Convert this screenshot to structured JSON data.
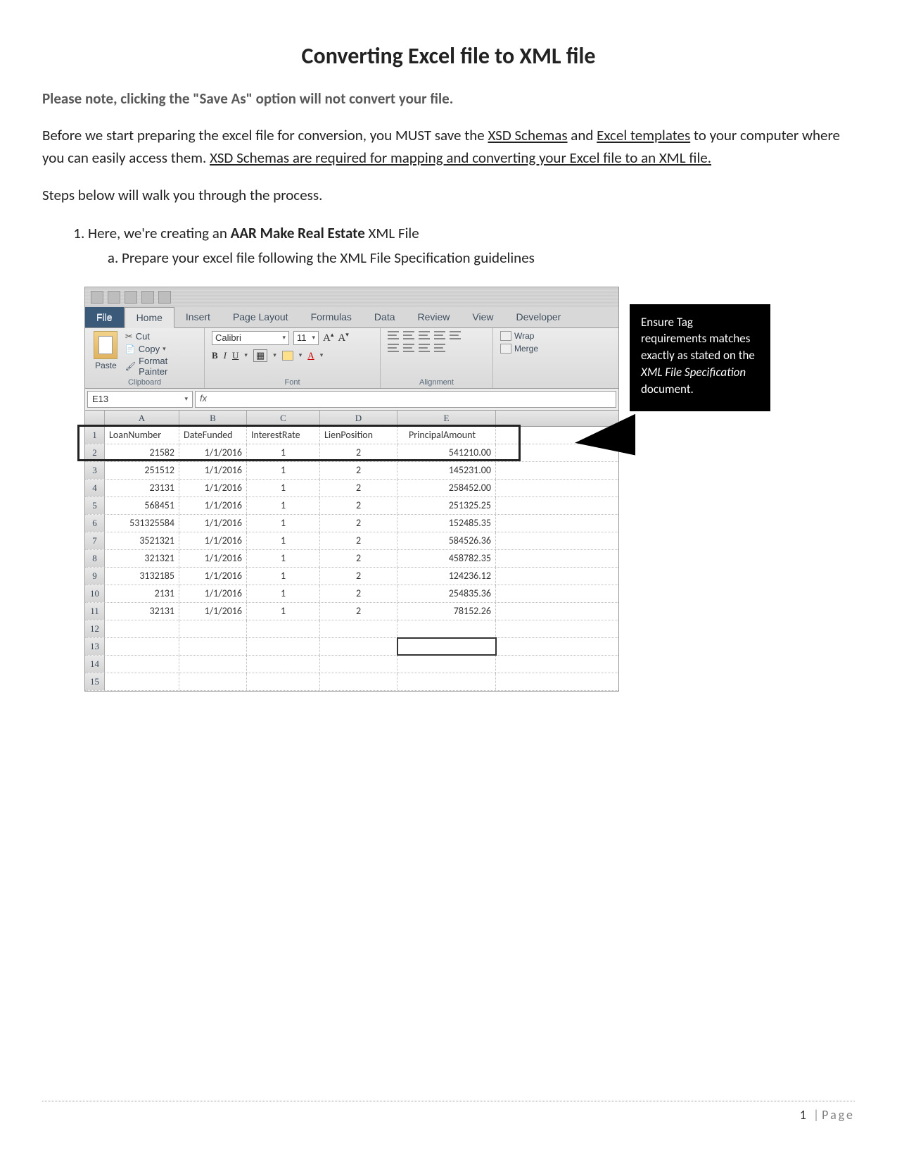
{
  "title": "Converting Excel file to XML file",
  "note": "Please note, clicking the \"Save As\" option will not convert your file.",
  "intro_a": "Before we start preparing the excel file for conversion, you MUST save the ",
  "intro_link1": "XSD Schemas",
  "intro_mid": " and ",
  "intro_link2": "Excel templates",
  "intro_b": " to your computer where you can easily access them. ",
  "intro_link3": "XSD Schemas are required for mapping and converting your Excel file to an XML file.",
  "intro2": "Steps below will walk you through the process.",
  "step1_a": "Here, we're creating an ",
  "step1_bold": "AAR Make Real Estate",
  "step1_b": " XML File",
  "step1a": "Prepare your excel file following the XML File Specification guidelines",
  "callout_a": "Ensure Tag requirements matches exactly as stated on the ",
  "callout_i": "XML File Specification",
  "callout_b": " document.",
  "ribbon": {
    "tabs": [
      "File",
      "Home",
      "Insert",
      "Page Layout",
      "Formulas",
      "Data",
      "Review",
      "View",
      "Developer"
    ],
    "cut": "Cut",
    "copy": "Copy",
    "format_painter": "Format Painter",
    "paste": "Paste",
    "clipboard_label": "Clipboard",
    "font_name": "Calibri",
    "font_size": "11",
    "font_label": "Font",
    "alignment_label": "Alignment",
    "wrap": "Wrap",
    "merge": "Merge",
    "name_box": "E13",
    "fx": "fx"
  },
  "columns": [
    "A",
    "B",
    "C",
    "D",
    "E"
  ],
  "headers": [
    "LoanNumber",
    "DateFunded",
    "InterestRate",
    "LienPosition",
    "PrincipalAmount"
  ],
  "rows": [
    {
      "n": "1"
    },
    {
      "n": "2",
      "a": "21582",
      "b": "1/1/2016",
      "c": "1",
      "d": "2",
      "e": "541210.00"
    },
    {
      "n": "3",
      "a": "251512",
      "b": "1/1/2016",
      "c": "1",
      "d": "2",
      "e": "145231.00"
    },
    {
      "n": "4",
      "a": "23131",
      "b": "1/1/2016",
      "c": "1",
      "d": "2",
      "e": "258452.00"
    },
    {
      "n": "5",
      "a": "568451",
      "b": "1/1/2016",
      "c": "1",
      "d": "2",
      "e": "251325.25"
    },
    {
      "n": "6",
      "a": "531325584",
      "b": "1/1/2016",
      "c": "1",
      "d": "2",
      "e": "152485.35"
    },
    {
      "n": "7",
      "a": "3521321",
      "b": "1/1/2016",
      "c": "1",
      "d": "2",
      "e": "584526.36"
    },
    {
      "n": "8",
      "a": "321321",
      "b": "1/1/2016",
      "c": "1",
      "d": "2",
      "e": "458782.35"
    },
    {
      "n": "9",
      "a": "3132185",
      "b": "1/1/2016",
      "c": "1",
      "d": "2",
      "e": "124236.12"
    },
    {
      "n": "10",
      "a": "2131",
      "b": "1/1/2016",
      "c": "1",
      "d": "2",
      "e": "254835.36"
    },
    {
      "n": "11",
      "a": "32131",
      "b": "1/1/2016",
      "c": "1",
      "d": "2",
      "e": "78152.26"
    },
    {
      "n": "12"
    },
    {
      "n": "13"
    },
    {
      "n": "14"
    },
    {
      "n": "15"
    }
  ],
  "footer": {
    "page": "1",
    "label": "Page"
  }
}
